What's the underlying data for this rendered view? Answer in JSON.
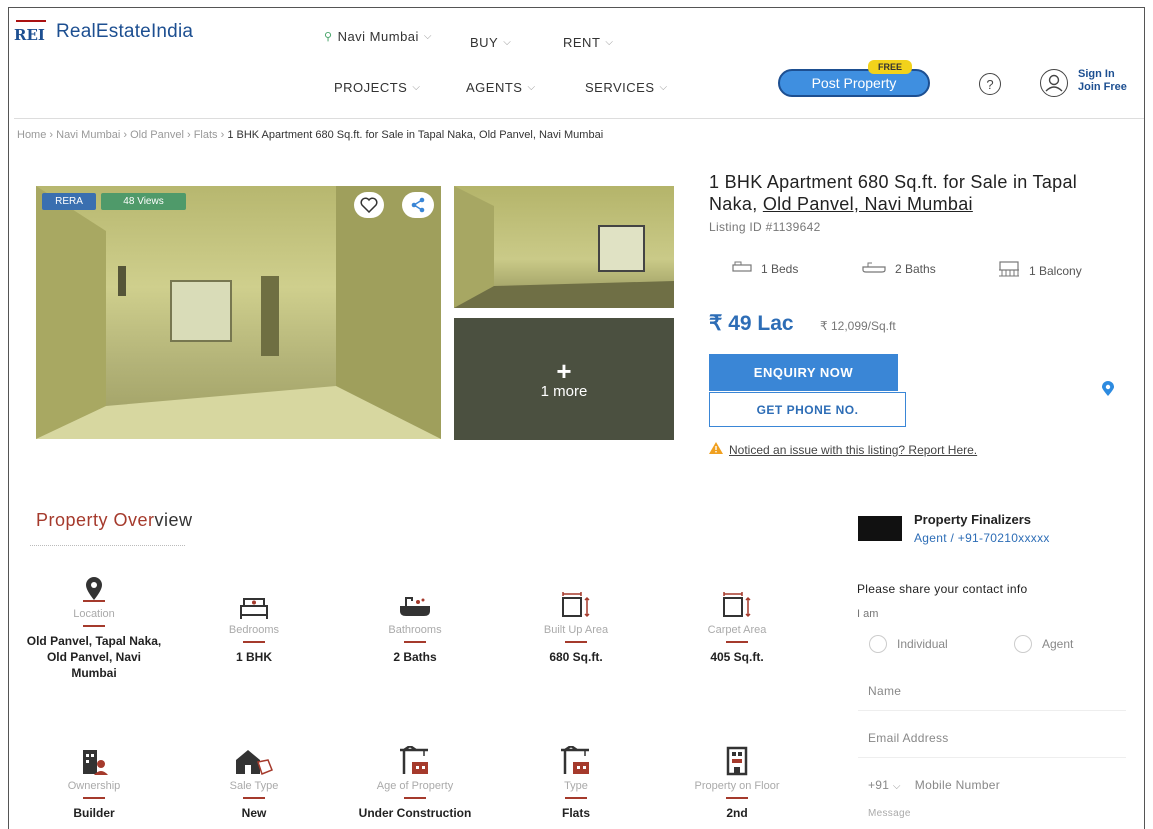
{
  "header": {
    "logo_mark": "REI",
    "logo_text": "RealEstateIndia",
    "location": "Navi Mumbai",
    "nav": {
      "buy": "BUY",
      "rent": "RENT",
      "projects": "PROJECTS",
      "agents": "AGENTS",
      "services": "SERVICES"
    },
    "post_property": "Post Property",
    "free_badge": "FREE",
    "sign_in": "Sign In",
    "join_free": "Join Free"
  },
  "breadcrumb": {
    "home": "Home",
    "city": "Navi Mumbai",
    "locality": "Old Panvel",
    "type": "Flats",
    "current": "1 BHK Apartment 680 Sq.ft. for Sale in Tapal Naka, Old Panvel, Navi Mumbai"
  },
  "gallery": {
    "rera_badge": "RERA",
    "views_badge": "48 Views",
    "more_count": "1 more"
  },
  "listing": {
    "title_prefix": "1 BHK Apartment 680 Sq.ft. for Sale in Tapal Naka,",
    "title_link": "Old Panvel, Navi Mumbai",
    "listing_id": "Listing ID #1139642",
    "beds": "1 Beds",
    "baths": "2 Baths",
    "balcony": "1 Balcony",
    "price": "₹ 49 Lac",
    "price_per_sqft": "₹ 12,099/Sq.ft",
    "enquiry_label": "ENQUIRY NOW",
    "phone_label": "GET PHONE NO.",
    "report_text": "Noticed an issue with this listing? Report Here."
  },
  "overview": {
    "title_part1": "Property Over",
    "title_part2": "view",
    "items": [
      {
        "label": "Location",
        "value": "Old Panvel, Tapal Naka, Old Panvel, Navi Mumbai"
      },
      {
        "label": "Bedrooms",
        "value": "1 BHK"
      },
      {
        "label": "Bathrooms",
        "value": "2 Baths"
      },
      {
        "label": "Built Up Area",
        "value": "680 Sq.ft."
      },
      {
        "label": "Carpet Area",
        "value": "405 Sq.ft."
      },
      {
        "label": "Ownership",
        "value": "Builder"
      },
      {
        "label": "Sale Type",
        "value": "New"
      },
      {
        "label": "Age of Property",
        "value": "Under Construction"
      },
      {
        "label": "Type",
        "value": "Flats"
      },
      {
        "label": "Property on Floor",
        "value": "2nd"
      }
    ]
  },
  "agent": {
    "name": "Property Finalizers",
    "subtitle": "Agent / +91-70210xxxxx",
    "share_prompt": "Please share your contact info",
    "i_am": "I am",
    "option_individual": "Individual",
    "option_agent": "Agent",
    "name_placeholder": "Name",
    "email_placeholder": "Email Address",
    "country_code": "+91",
    "mobile_placeholder": "Mobile Number",
    "message_placeholder": "Message"
  },
  "colors": {
    "brand_blue": "#1d4f91",
    "button_blue": "#3a86d6",
    "accent_red": "#a53a2c"
  }
}
